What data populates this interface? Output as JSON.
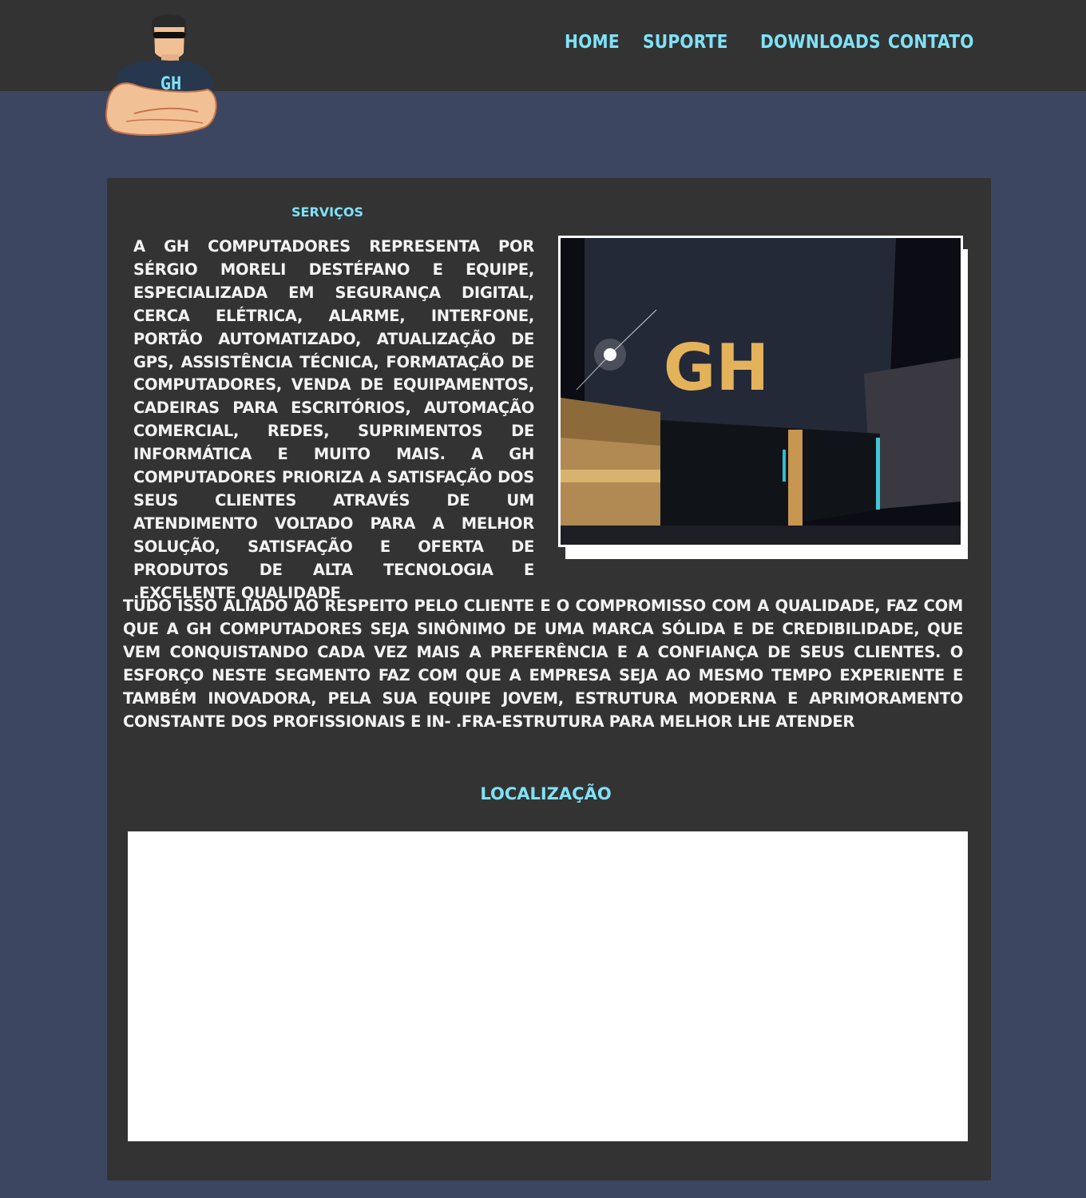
{
  "nav": {
    "home": "HOME",
    "suporte": "SUPORTE",
    "downloads": "DOWNLOADS",
    "contato": "CONTATO"
  },
  "logo": {
    "shirt_text": "GH"
  },
  "services": {
    "heading": "SERVIÇOS",
    "text": "A GH COMPUTADORES REPRESENTA POR SÉRGIO MORELI DESTÉFANO E EQUIPE, ESPECIALIZADA EM SEGURANÇA DIGITAL, CERCA ELÉTRICA, ALARME, INTERFONE, PORTÃO AUTOMATIZADO, ATUALIZAÇÃO DE GPS, ASSISTÊNCIA TÉCNICA, FORMATAÇÃO DE COMPUTADORES, VENDA DE EQUIPAMENTOS, CADEIRAS PARA ESCRITÓRIOS, AUTOMAÇÃO COMERCIAL, REDES, SUPRIMENTOS DE INFORMÁTICA E MUITO MAIS. A GH COMPUTADORES PRIORIZA A SATISFAÇÃO DOS SEUS CLIENTES ATRAVÉS DE UM ATENDIMENTO VOLTADO PARA A MELHOR SOLUÇÃO, SATISFAÇÃO E OFERTA DE PRODUTOS DE ALTA TECNOLOGIA E .EXCELENTE QUALIDADE",
    "photo_sign": "GH"
  },
  "about": {
    "text": "TUDO ISSO ALIADO AO RESPEITO PELO CLIENTE E O COMPROMISSO COM A QUALIDADE, FAZ COM QUE A GH COMPUTADORES SEJA SINÔNIMO DE UMA MARCA SÓLIDA E DE CREDIBILIDADE, QUE VEM CONQUISTANDO CADA VEZ MAIS A PREFERÊNCIA E A CONFIANÇA DE SEUS CLIENTES. O ESFORÇO NESTE SEGMENTO FAZ COM QUE A EMPRESA SEJA AO MESMO TEMPO EXPERIENTE E TAMBÉM INOVADORA, PELA SUA EQUIPE JOVEM, ESTRUTURA MODERNA E APRIMORAMENTO CONSTANTE DOS PROFISSIONAIS E IN- .FRA-ESTRUTURA PARA MELHOR LHE ATENDER"
  },
  "location": {
    "heading": "LOCALIZAÇÃO"
  },
  "colors": {
    "page_bg": "#3c4660",
    "bar_bg": "#333333",
    "accent": "#7fe2f7",
    "text": "#f3f3f3"
  }
}
